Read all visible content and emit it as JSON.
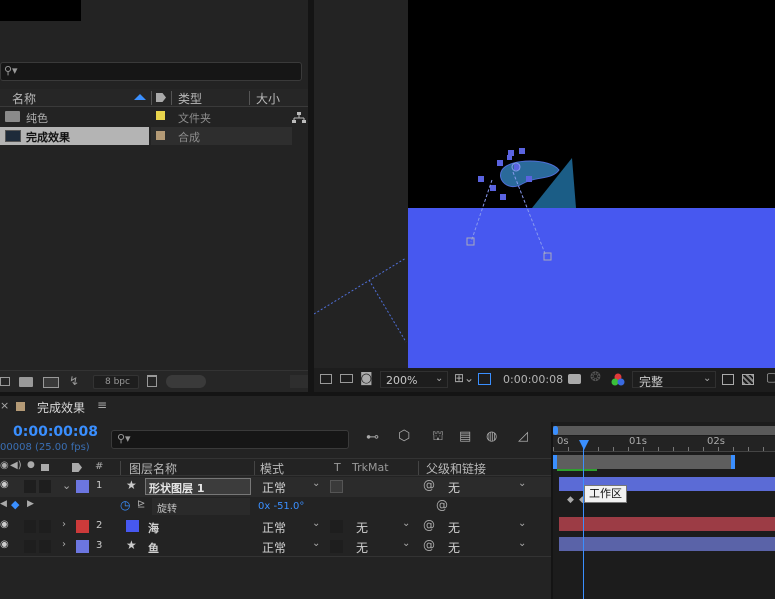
{
  "project": {
    "columns": {
      "name": "名称",
      "type": "类型",
      "size": "大小"
    },
    "rows": [
      {
        "name": "纯色",
        "type": "文件夹",
        "tag_color": "#e8d44c",
        "kind": "folder"
      },
      {
        "name": "完成效果",
        "type": "合成",
        "tag_color": "#b49a76",
        "kind": "composition"
      }
    ],
    "footer": {
      "bpc": "8 bpc"
    }
  },
  "viewer": {
    "zoom": "200%",
    "timecode": "0:00:00:08",
    "quality": "完整",
    "colors": {
      "background": "#000000",
      "sea": "#4758f0",
      "fish": "#2a6a9a"
    }
  },
  "timeline": {
    "comp_name": "完成效果",
    "timecode": "0:00:00:08",
    "frame_fps": "00008 (25.00 fps)",
    "columns": {
      "hash": "#",
      "layer_name": "图层名称",
      "mode": "模式",
      "t": "T",
      "trkmat": "TrkMat",
      "parent": "父级和链接"
    },
    "layers": [
      {
        "index": "1",
        "name": "形状图层 1",
        "mode": "正常",
        "trkmat": "",
        "parent": "无",
        "color": "#6c76e0",
        "selected": true
      },
      {
        "index": "2",
        "name": "海",
        "mode": "正常",
        "trkmat": "无",
        "parent": "无",
        "color": "#cc3a3a"
      },
      {
        "index": "3",
        "name": "鱼",
        "mode": "正常",
        "trkmat": "无",
        "parent": "无",
        "color": "#6c76e0"
      }
    ],
    "rotation": {
      "label": "旋转",
      "value": "0x -51.0°"
    },
    "ruler": [
      "0s",
      "01s",
      "02s"
    ],
    "tooltip": "工作区",
    "colors": {
      "playhead": "#3a8fff",
      "track_shape": "#5b6bd6",
      "track_sea": "#9c3c45",
      "track_fish": "#5a63a8"
    }
  }
}
